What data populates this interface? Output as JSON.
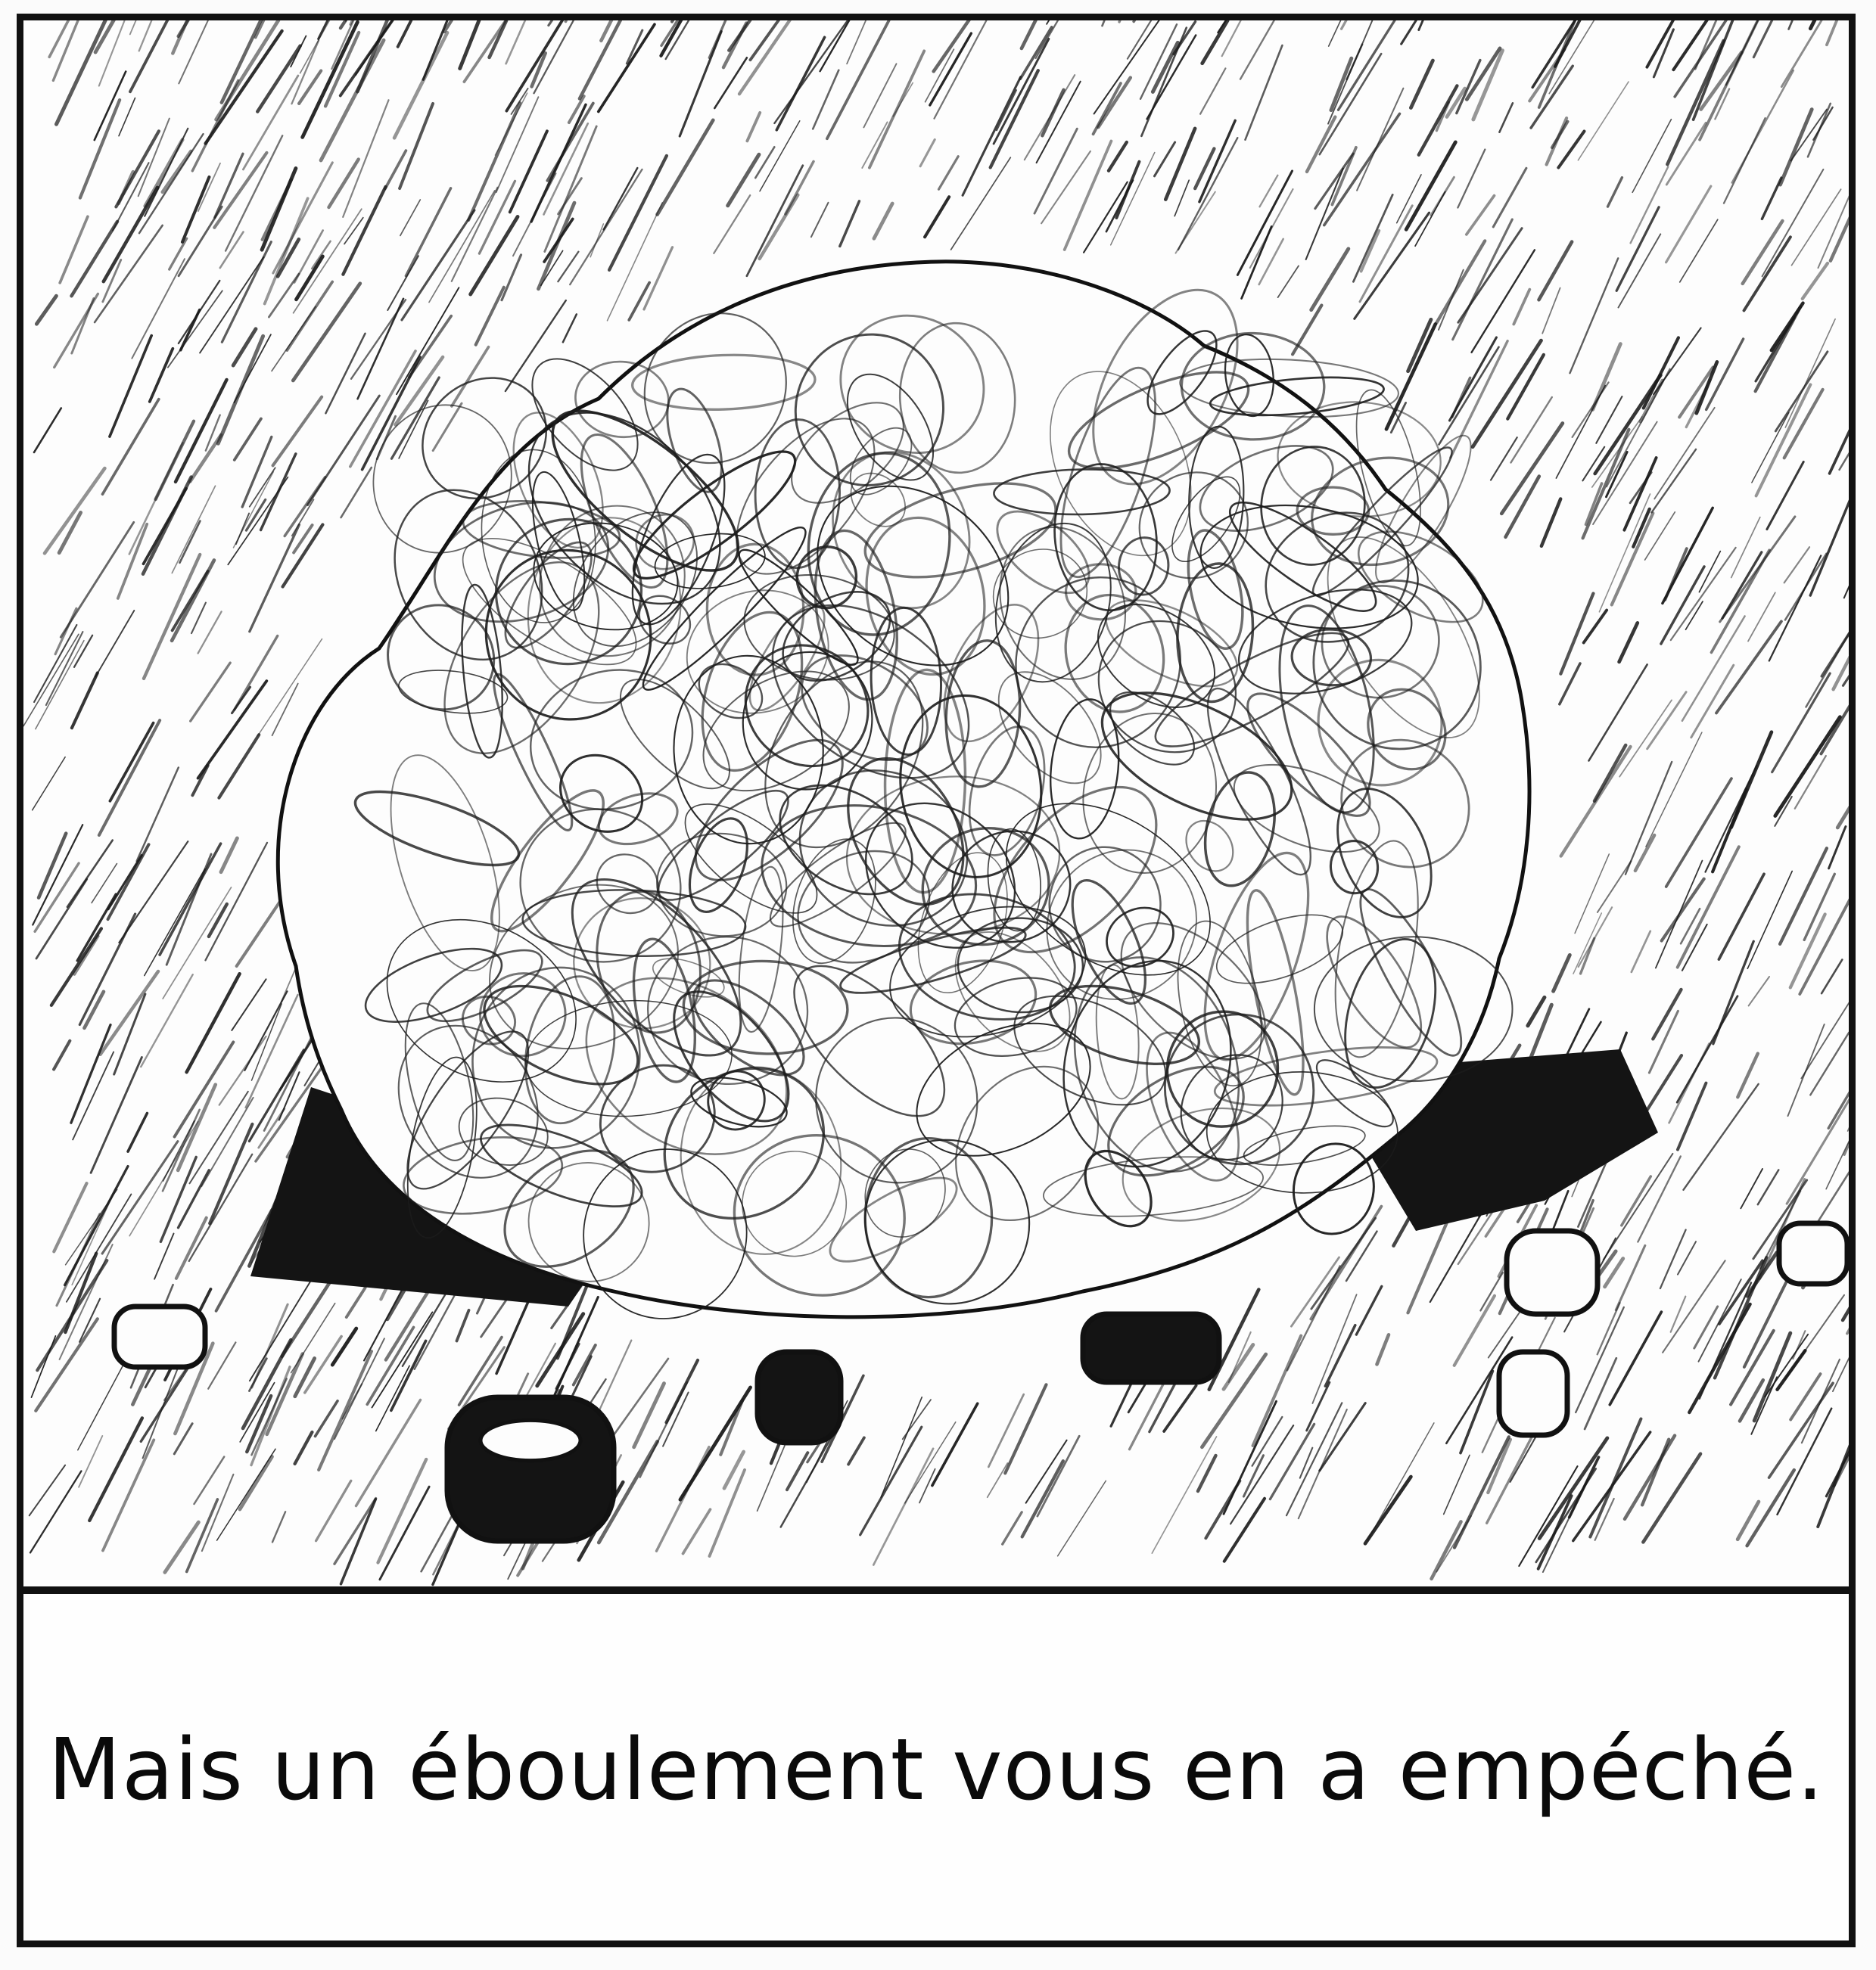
{
  "panel": {
    "caption": "Mais un éboulement vous en a empéché."
  },
  "colors": {
    "ink": "#111111",
    "paper": "#fdfdfd"
  },
  "illustration": {
    "subject": "boulder",
    "hatching": "diagonal-ink-strokes"
  }
}
